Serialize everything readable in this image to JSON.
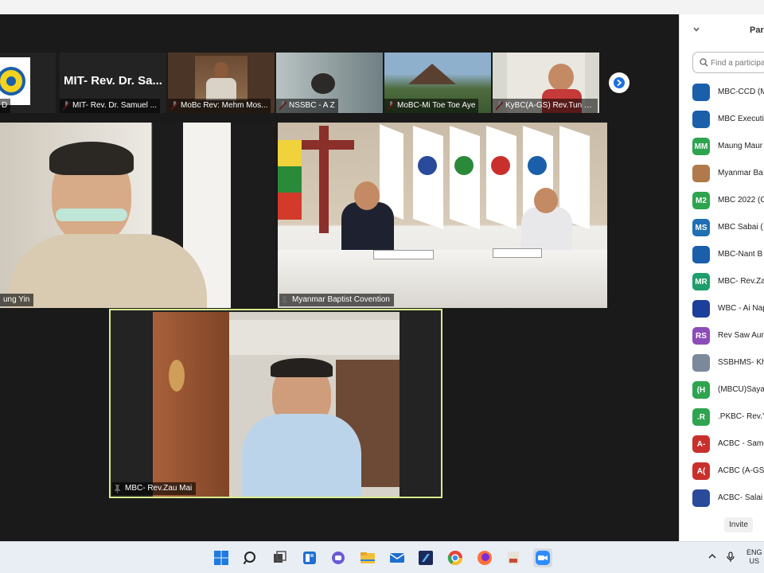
{
  "thumbnails": [
    {
      "label": "D",
      "big": ""
    },
    {
      "label": "MIT- Rev. Dr. Samuel ...",
      "big": "MIT-  Rev.  Dr.  Sa..."
    },
    {
      "label": "MoBc Rev: Mehm Mos...",
      "big": ""
    },
    {
      "label": "NSSBC - A Z",
      "big": ""
    },
    {
      "label": "MoBC-Mi Toe Toe Aye",
      "big": ""
    },
    {
      "label": "KyBC(A-GS) Rev.Tun T...",
      "big": ""
    }
  ],
  "tiles": {
    "left": {
      "label": "ung Yin"
    },
    "main": {
      "label": "Myanmar Baptist Covention"
    },
    "speaker": {
      "label": "MBC- Rev.Zau Mai"
    }
  },
  "panel": {
    "title": "Par",
    "search_placeholder": "Find a participa",
    "invite_label": "Invite",
    "participants": [
      {
        "initials": "",
        "name": "MBC-CCD (M",
        "color": "#1b5faa"
      },
      {
        "initials": "",
        "name": "MBC Executi",
        "color": "#1b5faa"
      },
      {
        "initials": "MM",
        "name": "Maung Maur",
        "color": "#2ea44f"
      },
      {
        "initials": "",
        "name": "Myanmar Ba",
        "color": "#b07a4a"
      },
      {
        "initials": "M2",
        "name": "MBC 2022 (C",
        "color": "#2ea44f"
      },
      {
        "initials": "MS",
        "name": "MBC Sabai (",
        "color": "#1f6fb2"
      },
      {
        "initials": "",
        "name": "MBC-Nant B",
        "color": "#1b5faa"
      },
      {
        "initials": "MR",
        "name": "MBC- Rev.Za",
        "color": "#1e9e6a"
      },
      {
        "initials": "",
        "name": "WBC - Ai Nap",
        "color": "#1b3f9a"
      },
      {
        "initials": "RS",
        "name": "Rev Saw Aur",
        "color": "#8b4db8"
      },
      {
        "initials": "",
        "name": "SSBHMS- Kh",
        "color": "#7a8a9a"
      },
      {
        "initials": "(H",
        "name": "(MBCU)Saya",
        "color": "#2ea44f"
      },
      {
        "initials": ".R",
        "name": ".PKBC- Rev.Y",
        "color": "#2ea44f"
      },
      {
        "initials": "A-",
        "name": "ACBC - Samc",
        "color": "#c9302c"
      },
      {
        "initials": "A(",
        "name": "ACBC (A-GS)",
        "color": "#c9302c"
      },
      {
        "initials": "",
        "name": "ACBC- Salai",
        "color": "#2a4a9a"
      }
    ]
  },
  "taskbar": {
    "lang_line1": "ENG",
    "lang_line2": "US"
  }
}
